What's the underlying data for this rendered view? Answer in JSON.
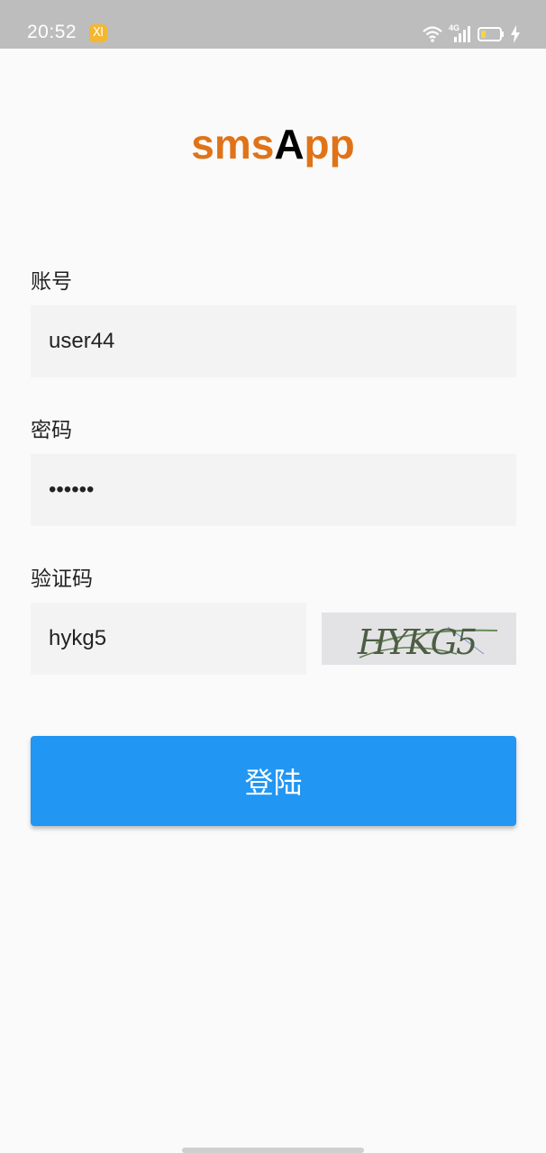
{
  "status_bar": {
    "time": "20:52",
    "network": "4G",
    "app_icon_glyph": "Ⅺ",
    "icons": [
      "app-notification-icon",
      "wifi-icon",
      "signal-icon",
      "battery-icon",
      "charging-icon"
    ]
  },
  "title": {
    "part1": "sms",
    "part2": "A",
    "part3": "pp"
  },
  "form": {
    "account_label": "账号",
    "account_value": "user44",
    "password_label": "密码",
    "password_value": "••••••",
    "captcha_label": "验证码",
    "captcha_value": "hykg5",
    "captcha_image_text": "HYKG5"
  },
  "login_button": {
    "label": "登陆",
    "color": "#2196f3"
  },
  "colors": {
    "title_accent": "#e07318",
    "background": "#fafafa",
    "input_background": "#f3f3f3",
    "status_bar": "#bdbdbd"
  }
}
